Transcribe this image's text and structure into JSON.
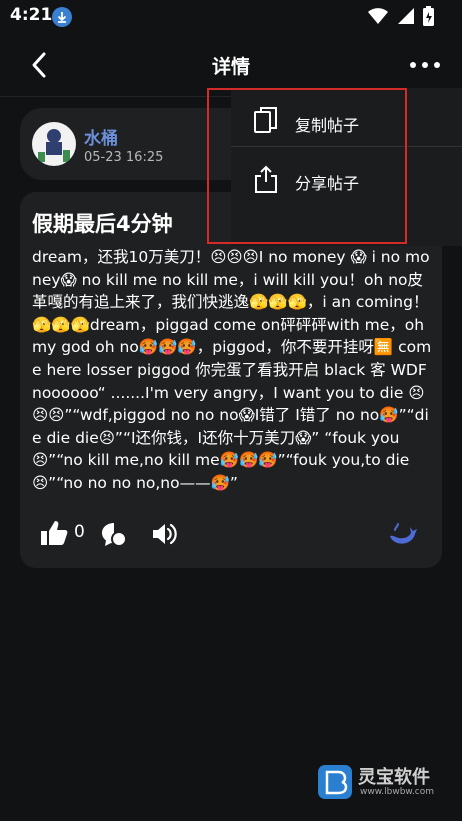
{
  "status_bar": {
    "time": "4:21"
  },
  "app_bar": {
    "title": "详情"
  },
  "author": {
    "name": "水桶",
    "time": "05-23 16:25"
  },
  "post": {
    "title": "假期最后4分钟",
    "body": "dream，还我10万美刀！😣😣😣I no money 😱 i no money😱 no kill me no kill me，i will kill you！oh no皮革嘎的有追上来了，我们快逃逸🫣🫣🫣，i an coming！🫣🫣🫣dream，piggad come on砰砰砰with me，oh my god oh no🥵🥵🥵，piggod，你不要开挂呀🈚 come here losser piggod 你完蛋了看我开启 black 客 WDF noooooo“ .......I'm very angry，I want you to die 😣😣😣”“wdf,piggod no no no😱I错了 I错了 no no🥵”“die die die😣”“I还你钱，I还你十万美刀😱” “fouk you😣”“no kill me,no kill me🥵🥵🥵”“fouk you,to die😣”“no no no no,no——🥵”",
    "like_count": "0"
  },
  "menu": {
    "items": [
      {
        "label": "复制帖子",
        "icon": "copy-icon"
      },
      {
        "label": "分享帖子",
        "icon": "share-icon"
      }
    ]
  },
  "watermark": {
    "name": "灵宝软件",
    "url": "www.lbwbw.com"
  }
}
